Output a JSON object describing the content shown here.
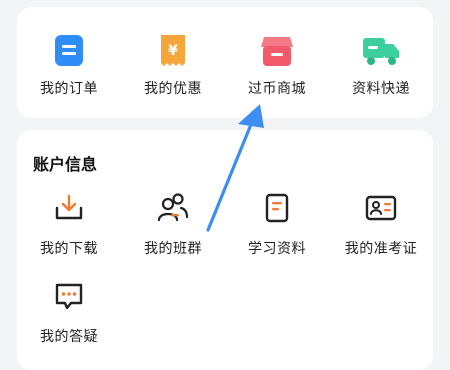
{
  "top_services": [
    {
      "label": "我的订单",
      "icon": "order-list-icon",
      "color": "#2f8df7"
    },
    {
      "label": "我的优惠",
      "icon": "coupon-yen-icon",
      "color": "#f6a53a"
    },
    {
      "label": "过币商城",
      "icon": "store-icon",
      "color": "#f2596a"
    },
    {
      "label": "资料快递",
      "icon": "delivery-truck-icon",
      "color": "#3dcf9e"
    }
  ],
  "account": {
    "title": "账户信息",
    "items": [
      {
        "label": "我的下载",
        "icon": "download-tray-icon"
      },
      {
        "label": "我的班群",
        "icon": "class-group-icon"
      },
      {
        "label": "学习资料",
        "icon": "study-material-icon"
      },
      {
        "label": "我的准考证",
        "icon": "admission-ticket-icon"
      },
      {
        "label": "我的答疑",
        "icon": "qa-chat-icon"
      }
    ]
  },
  "colors": {
    "accent_orange": "#f07a2f",
    "icon_dark": "#222222",
    "arrow_blue": "#3d8ef0"
  }
}
